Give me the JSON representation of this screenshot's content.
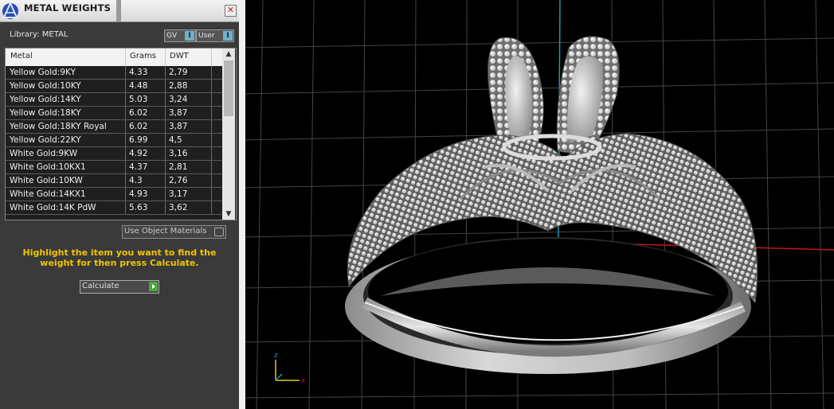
{
  "window": {
    "title": "METAL WEIGHTS",
    "close_glyph": "✕"
  },
  "library": {
    "label": "Library: METAL"
  },
  "toggles": [
    {
      "label": "GV",
      "indicator": "I"
    },
    {
      "label": "User",
      "indicator": "I"
    }
  ],
  "table": {
    "headers": [
      "Metal",
      "Grams",
      "DWT"
    ],
    "rows": [
      {
        "metal": "Yellow Gold:9KY",
        "grams": "4.33",
        "dwt": "2,79"
      },
      {
        "metal": "Yellow Gold:10KY",
        "grams": "4.48",
        "dwt": "2,88"
      },
      {
        "metal": "Yellow Gold:14KY",
        "grams": "5.03",
        "dwt": "3,24"
      },
      {
        "metal": "Yellow Gold:18KY",
        "grams": "6.02",
        "dwt": "3,87"
      },
      {
        "metal": "Yellow Gold:18KY Royal",
        "grams": "6.02",
        "dwt": "3,87"
      },
      {
        "metal": "Yellow Gold:22KY",
        "grams": "6.99",
        "dwt": "4,5"
      },
      {
        "metal": "White Gold:9KW",
        "grams": "4.92",
        "dwt": "3,16"
      },
      {
        "metal": "White Gold:10KX1",
        "grams": "4.37",
        "dwt": "2,81"
      },
      {
        "metal": "White Gold:10KW",
        "grams": "4.3",
        "dwt": "2,76"
      },
      {
        "metal": "White Gold:14KX1",
        "grams": "4.93",
        "dwt": "3,17"
      },
      {
        "metal": "White Gold:14K PdW",
        "grams": "5.63",
        "dwt": "3,62"
      }
    ],
    "scroll_up": "▲",
    "scroll_down": "▼"
  },
  "use_object_materials": {
    "label": "Use Object Materials",
    "checked": false
  },
  "instructions": "Highlight the item you want to find the weight for then press Calculate.",
  "calculate": {
    "label": "Calculate"
  },
  "viewport": {
    "axis_x": "x",
    "axis_z": "z"
  },
  "colors": {
    "panel_bg": "#3a3a3a",
    "accent_yellow": "#f2c400",
    "axis_blue": "#1a9ab0",
    "axis_red": "#c01818",
    "grid": "#4a4a4a"
  }
}
